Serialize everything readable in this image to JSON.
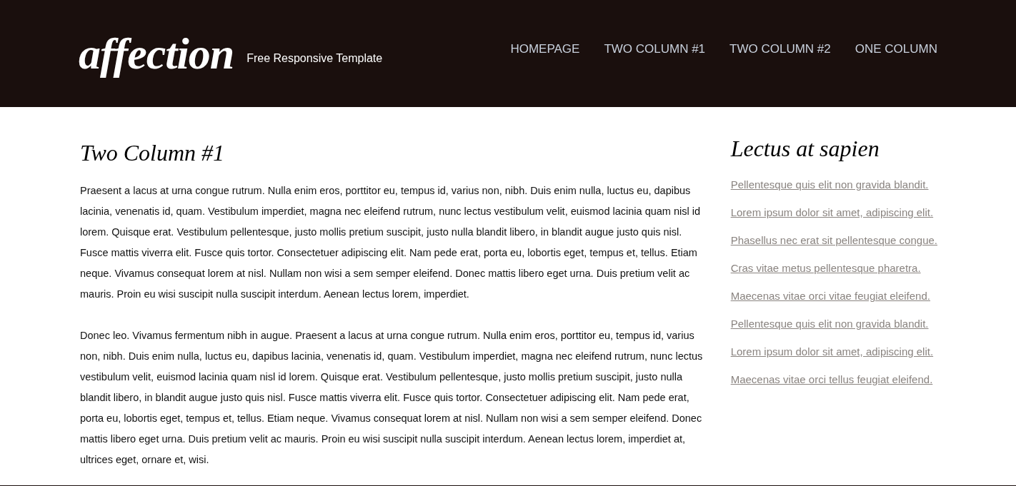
{
  "header": {
    "logo": "affection",
    "tagline": "Free Responsive Template"
  },
  "nav": [
    {
      "label": "HOMEPAGE"
    },
    {
      "label": "TWO COLUMN #1"
    },
    {
      "label": "TWO COLUMN #2"
    },
    {
      "label": "ONE COLUMN"
    }
  ],
  "main": {
    "title": "Two Column #1",
    "paragraphs": [
      "Praesent a lacus at urna congue rutrum. Nulla enim eros, porttitor eu, tempus id, varius non, nibh. Duis enim nulla, luctus eu, dapibus lacinia, venenatis id, quam. Vestibulum imperdiet, magna nec eleifend rutrum, nunc lectus vestibulum velit, euismod lacinia quam nisl id lorem. Quisque erat. Vestibulum pellentesque, justo mollis pretium suscipit, justo nulla blandit libero, in blandit augue justo quis nisl. Fusce mattis viverra elit. Fusce quis tortor. Consectetuer adipiscing elit. Nam pede erat, porta eu, lobortis eget, tempus et, tellus. Etiam neque. Vivamus consequat lorem at nisl. Nullam non wisi a sem semper eleifend. Donec mattis libero eget urna. Duis pretium velit ac mauris. Proin eu wisi suscipit nulla suscipit interdum. Aenean lectus lorem, imperdiet.",
      "Donec leo. Vivamus fermentum nibh in augue. Praesent a lacus at urna congue rutrum. Nulla enim eros, porttitor eu, tempus id, varius non, nibh. Duis enim nulla, luctus eu, dapibus lacinia, venenatis id, quam. Vestibulum imperdiet, magna nec eleifend rutrum, nunc lectus vestibulum velit, euismod lacinia quam nisl id lorem. Quisque erat. Vestibulum pellentesque, justo mollis pretium suscipit, justo nulla blandit libero, in blandit augue justo quis nisl. Fusce mattis viverra elit. Fusce quis tortor. Consectetuer adipiscing elit. Nam pede erat, porta eu, lobortis eget, tempus et, tellus. Etiam neque. Vivamus consequat lorem at nisl. Nullam non wisi a sem semper eleifend. Donec mattis libero eget urna. Duis pretium velit ac mauris. Proin eu wisi suscipit nulla suscipit interdum. Aenean lectus lorem, imperdiet at, ultrices eget, ornare et, wisi."
    ]
  },
  "sidebar": {
    "title": "Lectus at sapien",
    "links": [
      "Pellentesque quis elit non gravida blandit.",
      "Lorem ipsum dolor sit amet, adipiscing elit.",
      "Phasellus nec erat sit pellentesque congue.",
      "Cras vitae metus pellentesque pharetra.",
      "Maecenas vitae orci vitae feugiat eleifend.",
      "Pellentesque quis elit non gravida blandit.",
      "Lorem ipsum dolor sit amet, adipiscing elit.",
      "Maecenas vitae orci tellus feugiat eleifend."
    ]
  }
}
